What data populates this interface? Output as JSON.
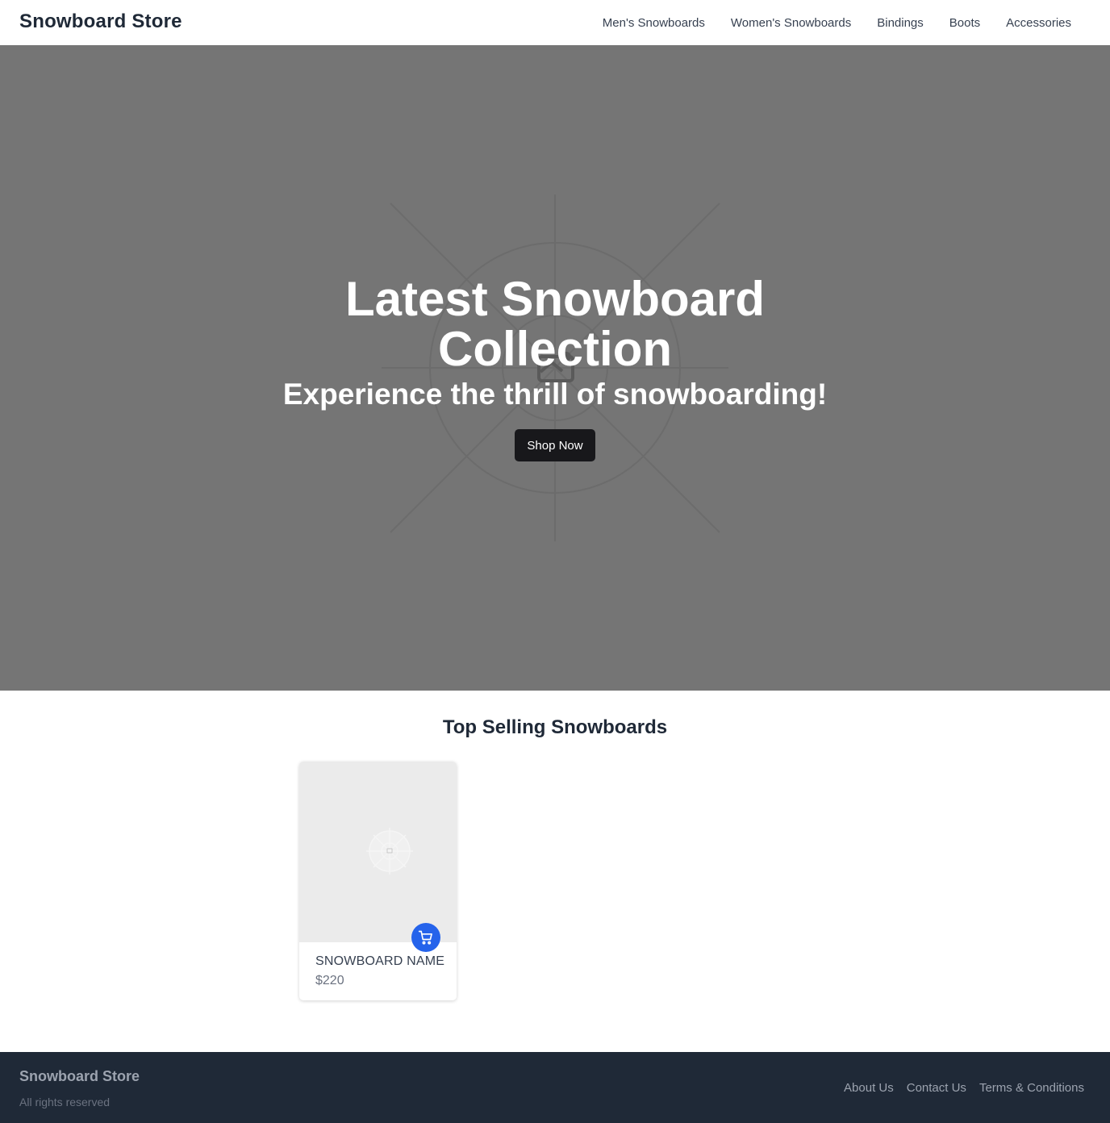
{
  "header": {
    "brand": "Snowboard Store",
    "nav": [
      {
        "label": "Men's Snowboards"
      },
      {
        "label": "Women's Snowboards"
      },
      {
        "label": "Bindings"
      },
      {
        "label": "Boots"
      },
      {
        "label": "Accessories"
      }
    ]
  },
  "hero": {
    "title_line1": "Latest Snowboard",
    "title_line2": "Collection",
    "subtitle": "Experience the thrill of snowboarding!",
    "cta_label": "Shop Now",
    "image_icon": "image-placeholder-icon",
    "background_color": "#757575"
  },
  "top_selling": {
    "title": "Top Selling Snowboards",
    "products": [
      {
        "name": "SNOWBOARD NAME",
        "price": "$220",
        "image_icon": "image-placeholder-icon",
        "cart_icon": "shopping-cart-icon"
      }
    ]
  },
  "footer": {
    "brand": "Snowboard Store",
    "rights": "All rights reserved",
    "links": [
      {
        "label": "About Us"
      },
      {
        "label": "Contact Us"
      },
      {
        "label": "Terms & Conditions"
      }
    ]
  },
  "colors": {
    "accent": "#2563eb",
    "dark_button": "#18181b",
    "footer_bg": "#1f2937"
  }
}
